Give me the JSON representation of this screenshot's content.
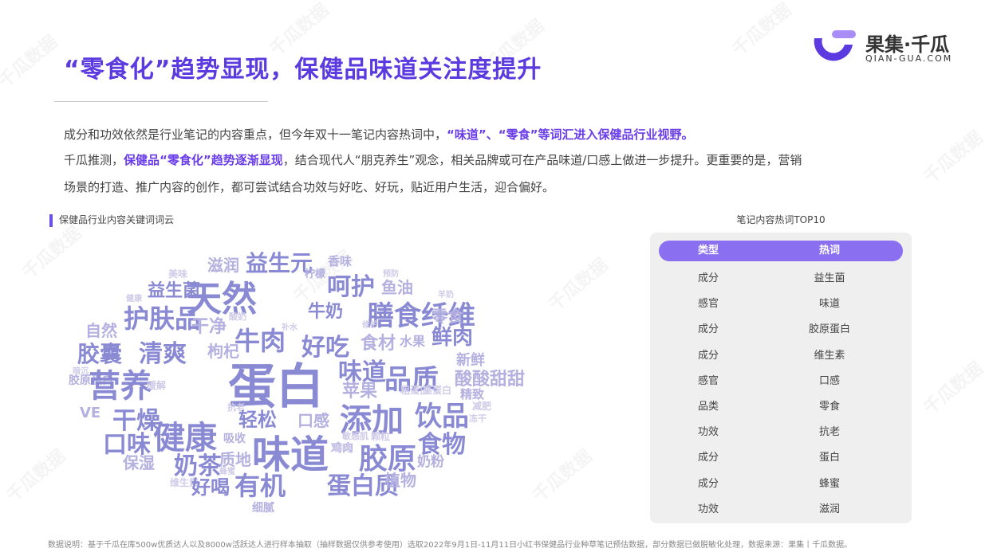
{
  "header": {
    "title": "“零食化”趋势显现，保健品味道关注度提升",
    "logo_name": "果集·千瓜",
    "logo_sub": "QIAN-GUA.COM",
    "watermark": "千瓜数据"
  },
  "intro": {
    "line1_a": "成分和功效依然是行业笔记的内容重点，但今年双十一笔记内容热词中，",
    "line1_hl": "“味道”、“零食”等词汇进入保健品行业视野。",
    "line2_a": "千瓜推测，",
    "line2_hl": "保健品“零食化”趋势逐渐显现",
    "line2_b": "，结合现代人“朋克养生”观念，相关品牌或可在产品味道/口感上做进一步提升。更重要的是，营销",
    "line3": "场景的打造、推广内容的创作，都可尝试结合功效与好吃、好玩，贴近用户生活，迎合偏好。"
  },
  "cloud_section": {
    "label": "保健品行业内容关键词词云",
    "words": [
      "滋润",
      "益生元",
      "香味",
      "预防",
      "美味",
      "柠檬",
      "益生菌",
      "天然",
      "呵护",
      "鱼油",
      "羊奶",
      "健康",
      "护肤品",
      "牛奶",
      "膳食纤维",
      "酸奶",
      "自然",
      "干净",
      "牛肉",
      "补水",
      "修护",
      "零食",
      "好吃",
      "食材",
      "水果",
      "鲜肉",
      "胶囊",
      "清爽",
      "枸杞",
      "暗沉",
      "胶原蛋白",
      "营养",
      "蛋白",
      "味道",
      "品质",
      "新鲜",
      "酸酸甜甜",
      "缓解",
      "苹果",
      "粗蛋白",
      "高蛋白",
      "精致",
      "VE",
      "干燥",
      "抗老",
      "轻松",
      "口感",
      "添加",
      "饮品",
      "减肥",
      "冻干",
      "口味",
      "健康",
      "吸收",
      "味道",
      "敏感肌",
      "颗粒",
      "食物",
      "鸡肉",
      "保湿",
      "奶茶",
      "质地",
      "咖啡",
      "胶原",
      "奶粉",
      "蜂蜜",
      "维生素",
      "好喝",
      "有机",
      "蛋白质",
      "植物",
      "细腻"
    ],
    "colors": {
      "primary": "#8a8ad4",
      "secondary": "#b4b0e0",
      "light": "#cfcbe8"
    }
  },
  "top10": {
    "title": "笔记内容热词TOP10",
    "headers": [
      "类型",
      "热词"
    ],
    "rows": [
      [
        "成分",
        "益生菌"
      ],
      [
        "感官",
        "味道"
      ],
      [
        "成分",
        "胶原蛋白"
      ],
      [
        "成分",
        "维生素"
      ],
      [
        "感官",
        "口感"
      ],
      [
        "品类",
        "零食"
      ],
      [
        "功效",
        "抗老"
      ],
      [
        "成分",
        "蛋白"
      ],
      [
        "成分",
        "蜂蜜"
      ],
      [
        "功效",
        "滋润"
      ]
    ],
    "header_color": "#8a6ff0"
  },
  "footer": {
    "note": "数据说明：基于千瓜在库500w优质达人以及8000w活跃达人进行样本抽取（抽样数据仅供参考使用）选取2022年9月1日-11月11日小红书保健品行业种草笔记预估数据，部分数据已做脱敏化处理，数据来源：果集丨千瓜数据。"
  },
  "theme": {
    "accent": "#5b3be0",
    "highlight": "#6a3de8"
  }
}
